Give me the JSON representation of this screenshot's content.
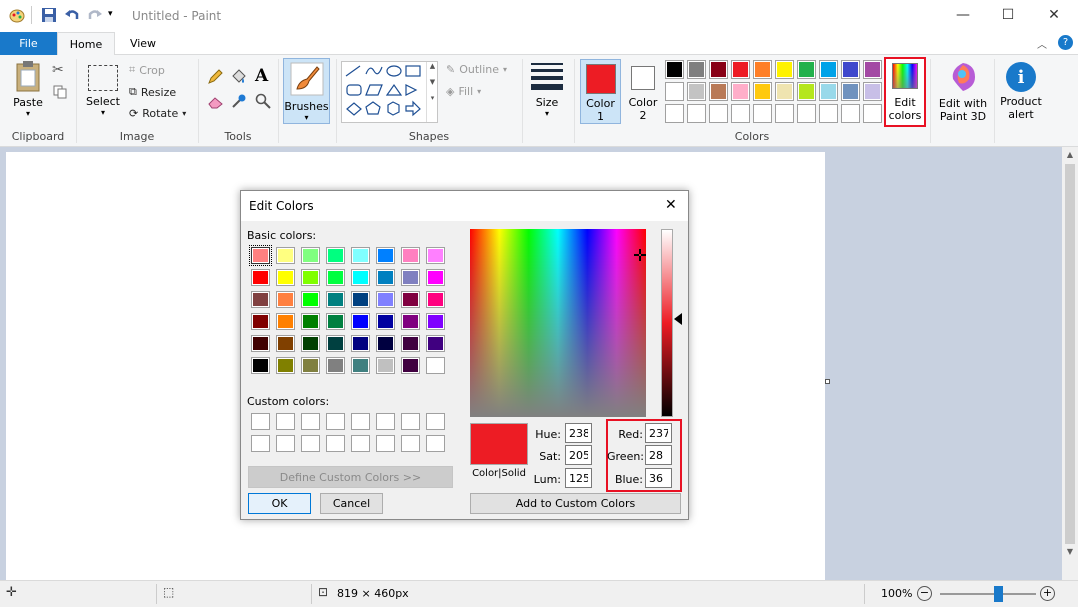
{
  "window": {
    "title": "Untitled - Paint"
  },
  "tabs": {
    "file": "File",
    "home": "Home",
    "view": "View"
  },
  "ribbon": {
    "clipboard": {
      "paste": "Paste",
      "label": "Clipboard"
    },
    "image": {
      "select": "Select",
      "crop": "Crop",
      "resize": "Resize",
      "rotate": "Rotate",
      "label": "Image"
    },
    "tools": {
      "label": "Tools"
    },
    "brushes": "Brushes",
    "shapes": {
      "outline": "Outline",
      "fill": "Fill",
      "label": "Shapes"
    },
    "size": "Size",
    "colors": {
      "color1": "Color",
      "color1_num": "1",
      "color2": "Color",
      "color2_num": "2",
      "label": "Colors",
      "color1_value": "#ed1c24",
      "palette_row1": [
        "#000000",
        "#7f7f7f",
        "#880015",
        "#ed1c24",
        "#ff7f27",
        "#fff200",
        "#22b14c",
        "#00a2e8",
        "#3f48cc",
        "#a349a4"
      ],
      "palette_row2": [
        "#ffffff",
        "#c3c3c3",
        "#b97a57",
        "#ffaec9",
        "#ffc90e",
        "#efe4b0",
        "#b5e61d",
        "#99d9ea",
        "#7092be",
        "#c8bfe7"
      ]
    },
    "edit_colors": {
      "line1": "Edit",
      "line2": "colors"
    },
    "paint3d": {
      "line1": "Edit with",
      "line2": "Paint 3D"
    },
    "alert": {
      "line1": "Product",
      "line2": "alert"
    }
  },
  "status": {
    "size": "819 × 460px",
    "zoom": "100%",
    "zoom_fraction": 0.6
  },
  "dialog": {
    "title": "Edit Colors",
    "basic_label": "Basic colors:",
    "custom_label": "Custom colors:",
    "define_button": "Define Custom Colors >>",
    "ok": "OK",
    "cancel": "Cancel",
    "color_solid": "Color|Solid",
    "add_button": "Add to Custom Colors",
    "hue_label": "Hue:",
    "hue": "238",
    "sat_label": "Sat:",
    "sat": "205",
    "lum_label": "Lum:",
    "lum": "125",
    "red_label": "Red:",
    "red": "237",
    "green_label": "Green:",
    "green": "28",
    "blue_label": "Blue:",
    "blue": "36",
    "preview_color": "#ed1c24",
    "basic_colors": [
      [
        "#ff8080",
        "#ffff80",
        "#80ff80",
        "#00ff80",
        "#80ffff",
        "#0080ff",
        "#ff80c0",
        "#ff80ff"
      ],
      [
        "#ff0000",
        "#ffff00",
        "#80ff00",
        "#00ff40",
        "#00ffff",
        "#0080c0",
        "#8080c0",
        "#ff00ff"
      ],
      [
        "#804040",
        "#ff8040",
        "#00ff00",
        "#008080",
        "#004080",
        "#8080ff",
        "#800040",
        "#ff0080"
      ],
      [
        "#800000",
        "#ff8000",
        "#008000",
        "#008040",
        "#0000ff",
        "#0000a0",
        "#800080",
        "#8000ff"
      ],
      [
        "#400000",
        "#804000",
        "#004000",
        "#004040",
        "#000080",
        "#000040",
        "#400040",
        "#400080"
      ],
      [
        "#000000",
        "#808000",
        "#808040",
        "#808080",
        "#408080",
        "#c0c0c0",
        "#400040",
        "#ffffff"
      ]
    ]
  }
}
